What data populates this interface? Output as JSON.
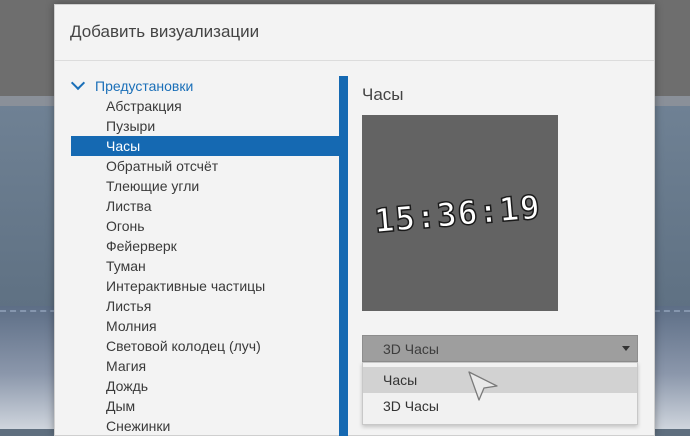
{
  "dialog": {
    "title": "Добавить визуализации"
  },
  "tree": {
    "root_label": "Предустановки",
    "items": [
      {
        "label": "Абстракция",
        "selected": false
      },
      {
        "label": "Пузыри",
        "selected": false
      },
      {
        "label": "Часы",
        "selected": true
      },
      {
        "label": "Обратный отсчёт",
        "selected": false
      },
      {
        "label": "Тлеющие угли",
        "selected": false
      },
      {
        "label": "Листва",
        "selected": false
      },
      {
        "label": "Огонь",
        "selected": false
      },
      {
        "label": "Фейерверк",
        "selected": false
      },
      {
        "label": "Туман",
        "selected": false
      },
      {
        "label": "Интерактивные частицы",
        "selected": false
      },
      {
        "label": "Листья",
        "selected": false
      },
      {
        "label": "Молния",
        "selected": false
      },
      {
        "label": "Световой колодец (луч)",
        "selected": false
      },
      {
        "label": "Магия",
        "selected": false
      },
      {
        "label": "Дождь",
        "selected": false
      },
      {
        "label": "Дым",
        "selected": false
      },
      {
        "label": "Снежинки",
        "selected": false
      }
    ]
  },
  "preview": {
    "title": "Часы",
    "clock_text": "15:36:19"
  },
  "select": {
    "value": "3D Часы",
    "options": [
      {
        "label": "Часы",
        "hover": true
      },
      {
        "label": "3D Часы",
        "hover": false
      }
    ]
  },
  "colors": {
    "accent": "#1569b2",
    "preview_bg": "#636363",
    "dialog_bg": "#f3f3f3"
  }
}
